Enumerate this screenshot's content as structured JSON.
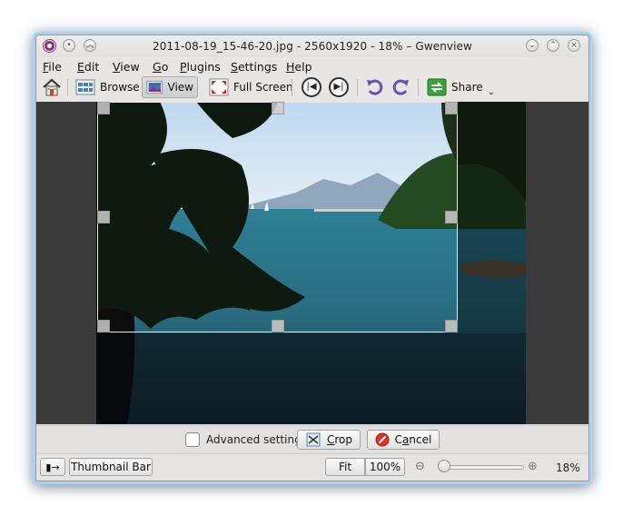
{
  "window": {
    "title": "2011-08-19_15-46-20.jpg - 2560x1920 - 18% – Gwenview",
    "icons": {
      "app": "gwenview-icon",
      "menu": "window-menu-icon",
      "keep_above": "keep-above-icon",
      "minimize": "minimize-icon",
      "maximize": "maximize-icon",
      "close": "close-icon"
    }
  },
  "menubar": {
    "items": [
      {
        "label": "File",
        "mnemonic": "F",
        "rest": "ile"
      },
      {
        "label": "Edit",
        "mnemonic": "E",
        "rest": "dit"
      },
      {
        "label": "View",
        "mnemonic": "V",
        "rest": "iew"
      },
      {
        "label": "Go",
        "mnemonic": "G",
        "rest": "o"
      },
      {
        "label": "Plugins",
        "mnemonic": "P",
        "rest": "lugins"
      },
      {
        "label": "Settings",
        "mnemonic": "S",
        "rest": "ettings"
      },
      {
        "label": "Help",
        "mnemonic": "H",
        "rest": "elp"
      }
    ]
  },
  "toolbar": {
    "browse": "Browse",
    "view": "View",
    "fullscreen": "Full Screen",
    "share": "Share",
    "icons": [
      "home-icon",
      "browse-icon",
      "view-icon",
      "fullscreen-icon",
      "previous-icon",
      "next-icon",
      "rotate-left-icon",
      "rotate-right-icon",
      "share-icon",
      "chevron-down-icon"
    ]
  },
  "cropbar": {
    "advanced_settings": "Advanced settings",
    "advanced_checked": false,
    "crop_mnemonic": "C",
    "crop_rest": "rop",
    "cancel_mnemonic": "a",
    "cancel_prefix": "C",
    "cancel_rest": "ncel"
  },
  "statusbar": {
    "thumbnail_bar": "Thumbnail Bar",
    "fit": "Fit",
    "zoom_100": "100%",
    "zoom_value": "18%",
    "zoom_fraction": 0.0
  },
  "colors": {
    "accent": "#b4d0e6",
    "viewer_bg": "#3a3a3a",
    "cancel_red": "#d9342b",
    "share_green": "#3aa33a"
  }
}
